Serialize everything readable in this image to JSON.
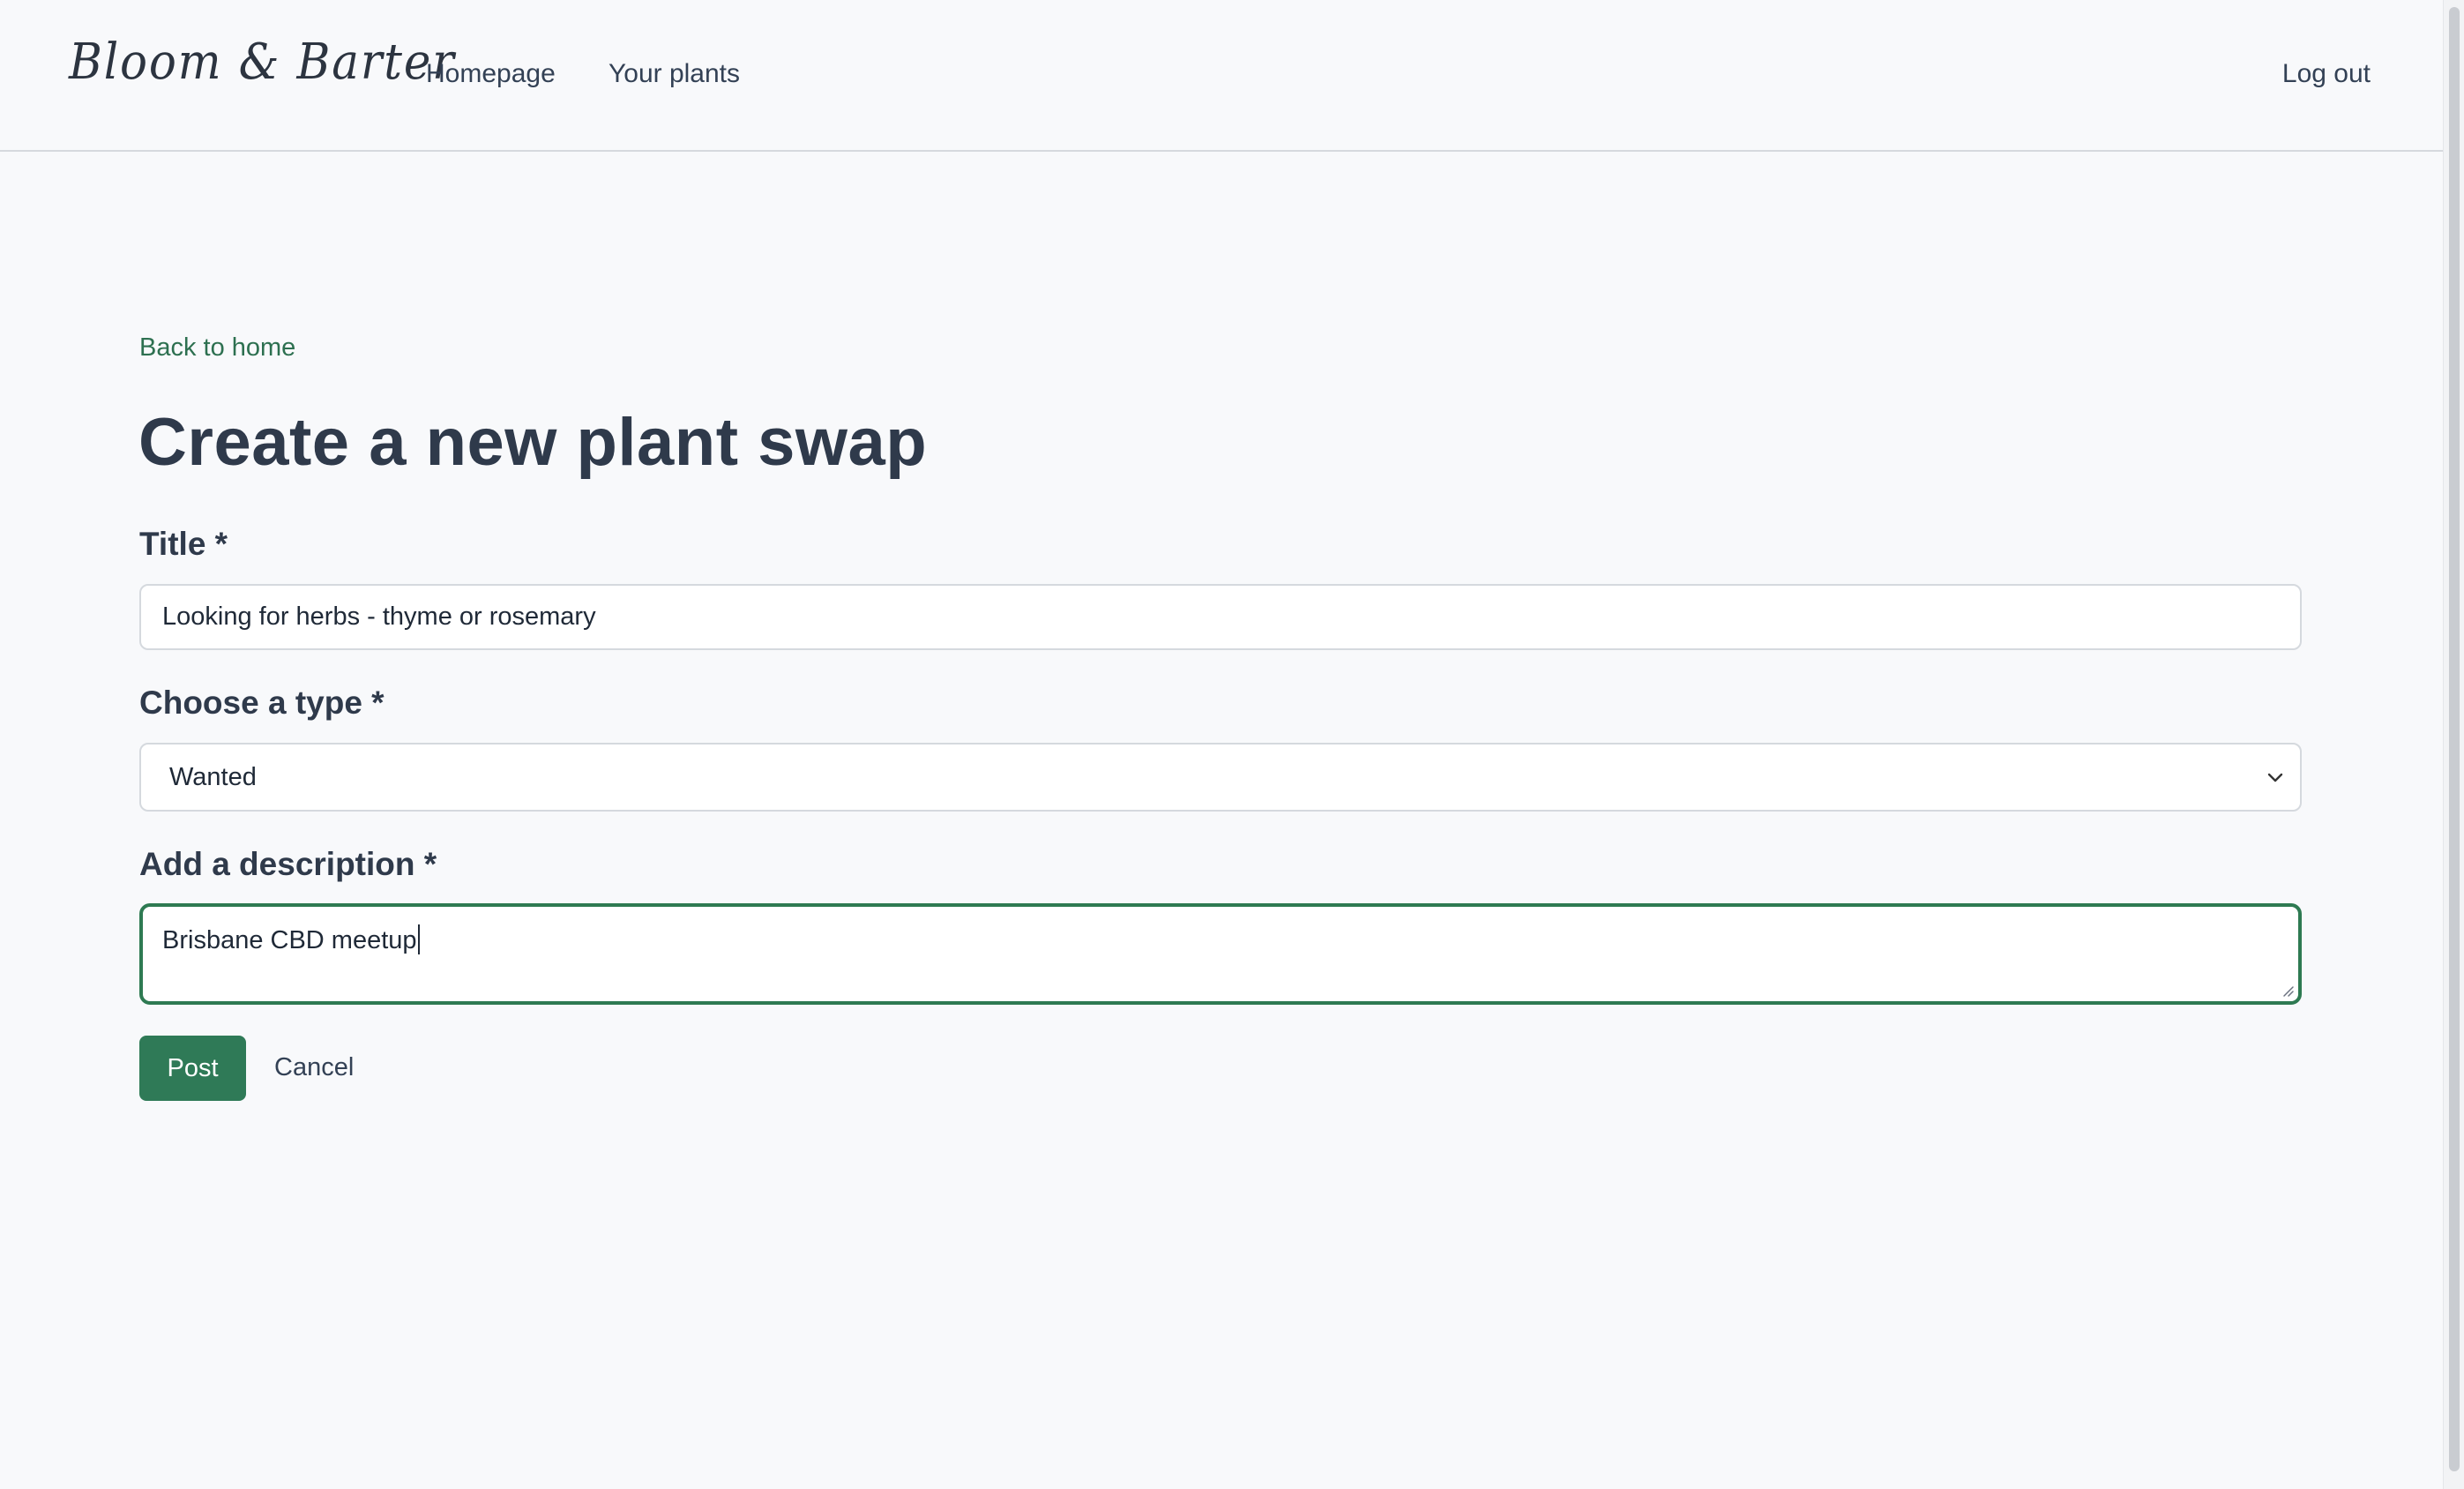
{
  "header": {
    "brand": "Bloom & Barter",
    "nav": {
      "homepage": "Homepage",
      "your_plants": "Your plants"
    },
    "logout": "Log out"
  },
  "main": {
    "back_link": "Back to home",
    "page_title": "Create a new plant swap",
    "form": {
      "title_label": "Title *",
      "title_value": "Looking for herbs - thyme or rosemary",
      "type_label": "Choose a type *",
      "type_value": "Wanted",
      "description_label": "Add a description *",
      "description_value": "Brisbane CBD meetup",
      "post_button": "Post",
      "cancel_link": "Cancel"
    }
  },
  "colors": {
    "accent": "#2f7a57",
    "link": "#2d7050",
    "text": "#334155",
    "heading": "#2f3a4b",
    "background": "#f8f9fb"
  },
  "icons": {
    "select_arrow": "chevron-down-icon",
    "textarea_resize": "resize-grip-icon"
  }
}
